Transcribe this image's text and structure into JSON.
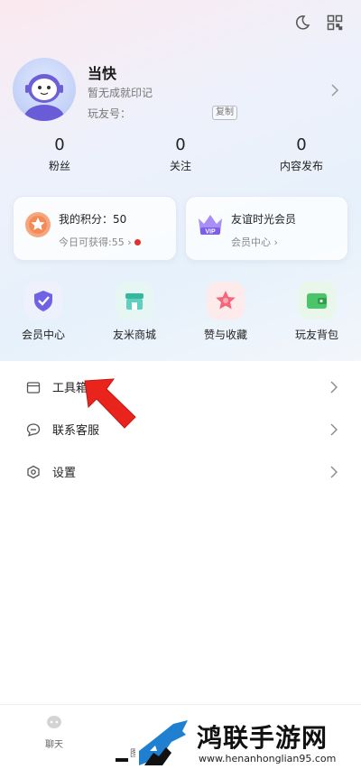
{
  "profile": {
    "name": "当快",
    "motto": "暂无成就印记",
    "uid_label": "玩友号：",
    "copy_label": "复制"
  },
  "stats": [
    {
      "value": "0",
      "label": "粉丝"
    },
    {
      "value": "0",
      "label": "关注"
    },
    {
      "value": "0",
      "label": "内容发布"
    }
  ],
  "points_card": {
    "title": "我的积分：50",
    "subtitle": "今日可获得:55 ›"
  },
  "member_card": {
    "title": "友谊时光会员",
    "subtitle": "会员中心 ›",
    "badge": "VIP"
  },
  "shortcuts": [
    {
      "label": "会员中心",
      "icon": "shield-check-icon"
    },
    {
      "label": "友米商城",
      "icon": "store-icon"
    },
    {
      "label": "赞与收藏",
      "icon": "star-icon"
    },
    {
      "label": "玩友背包",
      "icon": "wallet-icon"
    }
  ],
  "menu": [
    {
      "label": "工具箱",
      "icon": "toolbox-icon"
    },
    {
      "label": "联系客服",
      "icon": "chat-bubble-icon"
    },
    {
      "label": "设置",
      "icon": "hexagon-settings-icon"
    }
  ],
  "tabbar": {
    "chat_label": "聊天",
    "partial_label": "图"
  },
  "watermark": {
    "title": "鸿联手游网",
    "url": "www.henanhonglian95.com"
  },
  "colors": {
    "accent_red": "#e2312a",
    "points_orange": "#f39a62",
    "vip_purple": "#8b6cf0",
    "store_teal": "#3bbfa8"
  }
}
